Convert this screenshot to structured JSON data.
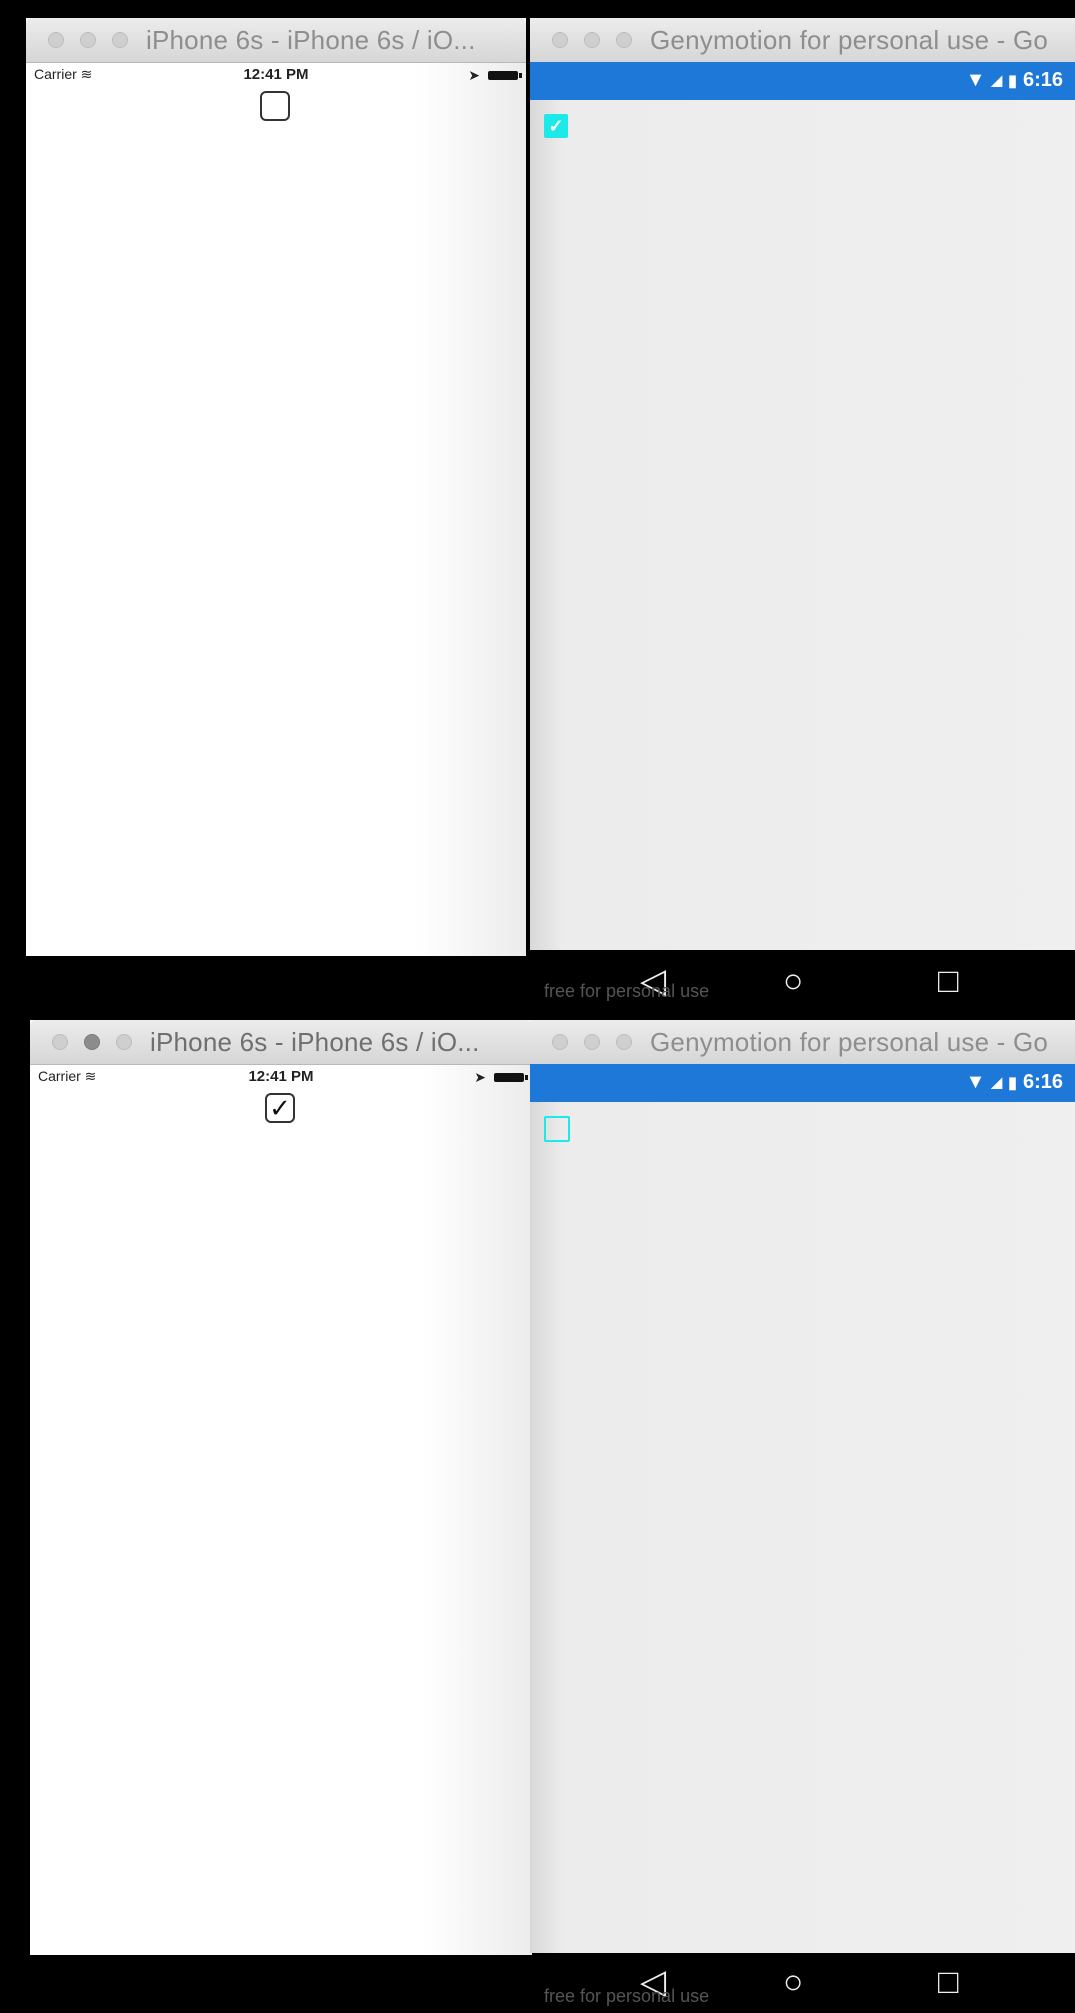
{
  "top": {
    "ios_window": {
      "title": "iPhone 6s - iPhone 6s / iO...",
      "carrier": "Carrier",
      "time": "12:41 PM",
      "checkbox_checked": false
    },
    "android_window": {
      "title": "Genymotion for personal use - Go",
      "clock": "6:16",
      "checkbox_checked": true
    },
    "navbar": {
      "watermark": "free for personal use"
    }
  },
  "bottom": {
    "ios_window": {
      "title": "iPhone 6s - iPhone 6s / iO...",
      "carrier": "Carrier",
      "time": "12:41 PM",
      "checkbox_checked": true,
      "check_glyph": "✓"
    },
    "android_window": {
      "title": "Genymotion for personal use - Go",
      "clock": "6:16",
      "checkbox_checked": false
    },
    "navbar": {
      "watermark": "free for personal use"
    }
  },
  "android_nav": {
    "back": "◁",
    "home": "○",
    "recents": "□"
  },
  "colors": {
    "android_status": "#1e78d7",
    "checkbox_accent": "#1de9e9"
  }
}
